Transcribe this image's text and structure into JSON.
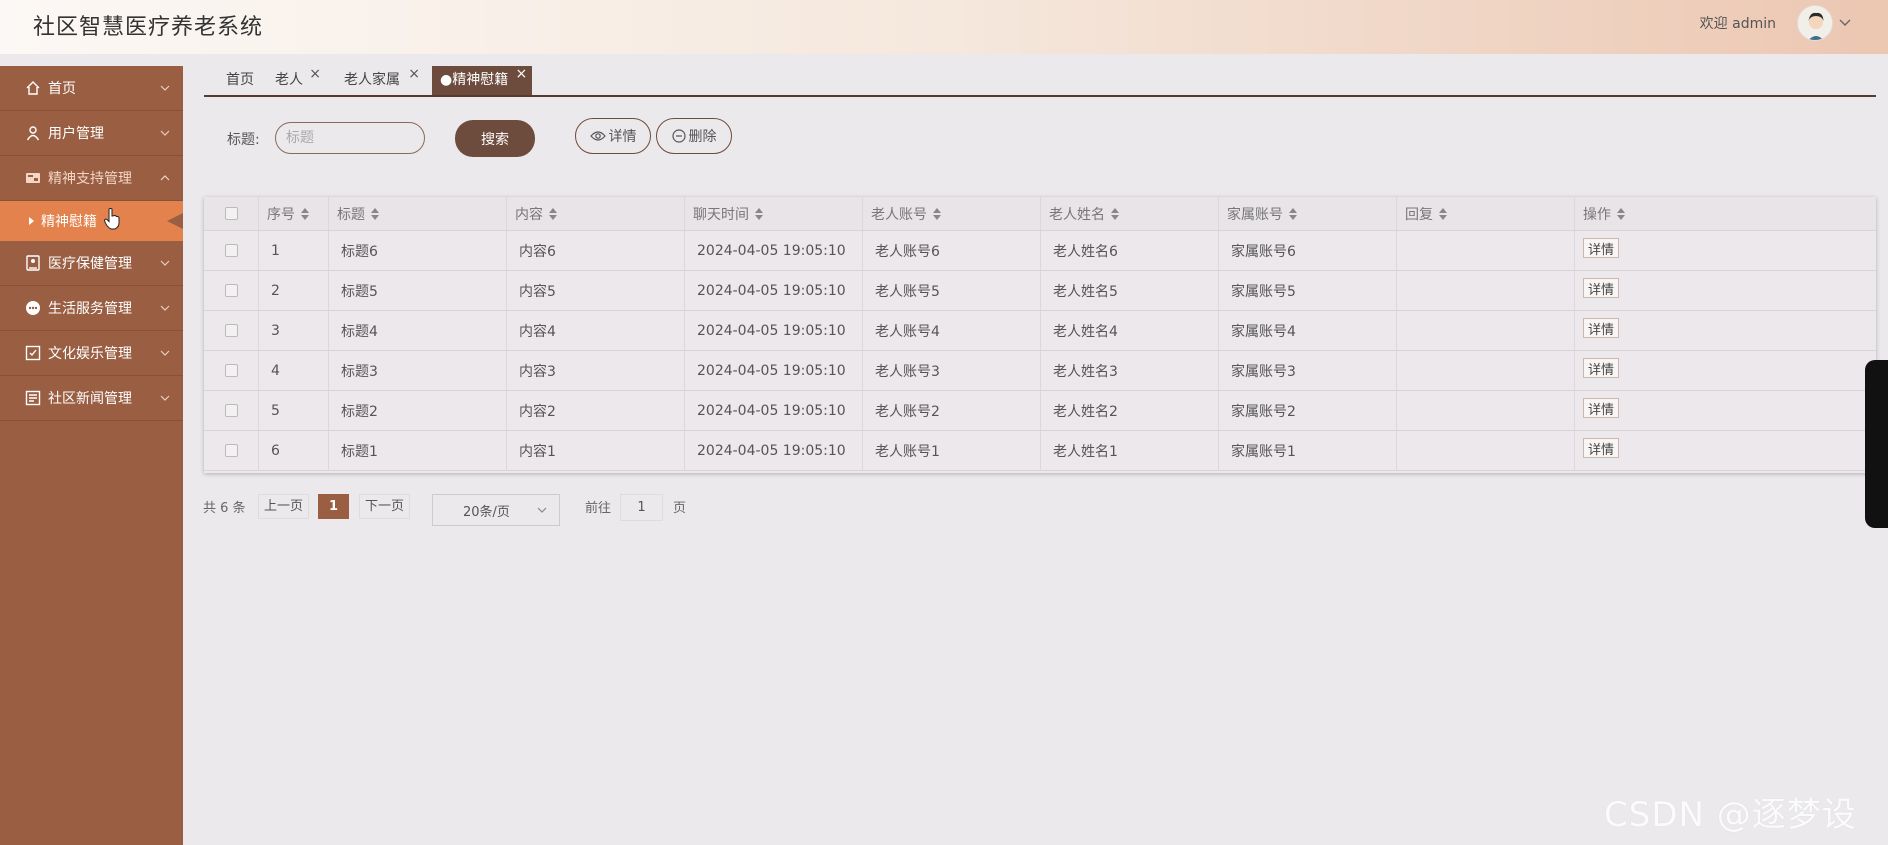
{
  "header": {
    "title": "社区智慧医疗养老系统",
    "welcome": "欢迎 admin"
  },
  "sidebar": {
    "items": [
      {
        "label": "首页",
        "icon": "home-icon"
      },
      {
        "label": "用户管理",
        "icon": "user-icon"
      },
      {
        "label": "精神支持管理",
        "icon": "support-icon",
        "open": true,
        "children": [
          {
            "label": "精神慰籍",
            "active": true
          }
        ]
      },
      {
        "label": "医疗保健管理",
        "icon": "medical-icon"
      },
      {
        "label": "生活服务管理",
        "icon": "service-icon"
      },
      {
        "label": "文化娱乐管理",
        "icon": "entertainment-icon"
      },
      {
        "label": "社区新闻管理",
        "icon": "news-icon"
      }
    ]
  },
  "tabs": [
    {
      "label": "首页",
      "closable": false
    },
    {
      "label": "老人",
      "closable": true
    },
    {
      "label": "老人家属",
      "closable": true
    },
    {
      "label": "●精神慰籍",
      "closable": true,
      "active": true
    }
  ],
  "search": {
    "label": "标题:",
    "placeholder": "标题",
    "search_button": "搜索",
    "detail_button": "详情",
    "delete_button": "删除"
  },
  "table": {
    "columns": [
      "序号",
      "标题",
      "内容",
      "聊天时间",
      "老人账号",
      "老人姓名",
      "家属账号",
      "回复",
      "操作"
    ],
    "rows": [
      {
        "no": "1",
        "title": "标题6",
        "content": "内容6",
        "time": "2024-04-05 19:05:10",
        "elder_account": "老人账号6",
        "elder_name": "老人姓名6",
        "family_account": "家属账号6",
        "reply": "",
        "action": "详情"
      },
      {
        "no": "2",
        "title": "标题5",
        "content": "内容5",
        "time": "2024-04-05 19:05:10",
        "elder_account": "老人账号5",
        "elder_name": "老人姓名5",
        "family_account": "家属账号5",
        "reply": "",
        "action": "详情"
      },
      {
        "no": "3",
        "title": "标题4",
        "content": "内容4",
        "time": "2024-04-05 19:05:10",
        "elder_account": "老人账号4",
        "elder_name": "老人姓名4",
        "family_account": "家属账号4",
        "reply": "",
        "action": "详情"
      },
      {
        "no": "4",
        "title": "标题3",
        "content": "内容3",
        "time": "2024-04-05 19:05:10",
        "elder_account": "老人账号3",
        "elder_name": "老人姓名3",
        "family_account": "家属账号3",
        "reply": "",
        "action": "详情"
      },
      {
        "no": "5",
        "title": "标题2",
        "content": "内容2",
        "time": "2024-04-05 19:05:10",
        "elder_account": "老人账号2",
        "elder_name": "老人姓名2",
        "family_account": "家属账号2",
        "reply": "",
        "action": "详情"
      },
      {
        "no": "6",
        "title": "标题1",
        "content": "内容1",
        "time": "2024-04-05 19:05:10",
        "elder_account": "老人账号1",
        "elder_name": "老人姓名1",
        "family_account": "家属账号1",
        "reply": "",
        "action": "详情"
      }
    ]
  },
  "pagination": {
    "total": "共 6 条",
    "prev": "上一页",
    "current": "1",
    "next": "下一页",
    "page_size": "20条/页",
    "goto_label": "前往",
    "goto_value": "1",
    "page_unit": "页"
  },
  "watermark": "CSDN @逐梦设计",
  "colors": {
    "sidebar": "#9a5e43",
    "active_item": "#e4824e",
    "primary_button": "#6d4c3d",
    "page_bg": "#ebe9ec"
  }
}
